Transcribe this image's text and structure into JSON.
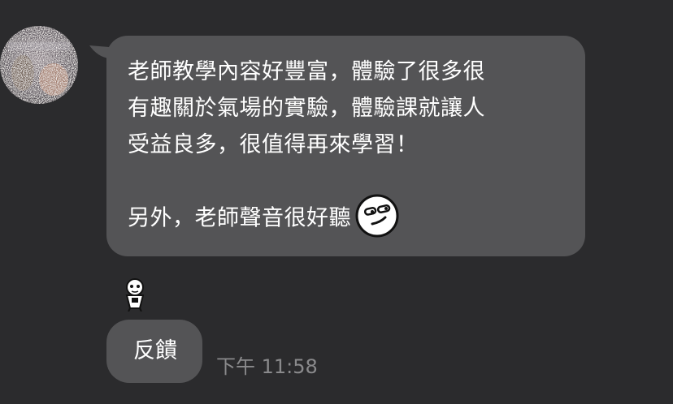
{
  "message": {
    "lines": [
      "老師教學內容好豐富，體驗了很多很",
      "有趣關於氣場的實驗，體驗課就讓人",
      "受益良多，很值得再來學習！",
      "",
      "另外，老師聲音很好聽"
    ],
    "emoji_icon": "smug-face-sticker-icon"
  },
  "reaction": {
    "icon": "small-character-sticker-icon"
  },
  "feedback_button": {
    "label": "反饋"
  },
  "timestamp": "下午 11:58",
  "colors": {
    "background": "#2b2b2d",
    "bubble": "#545456",
    "text": "#ffffff",
    "timestamp": "#8a8a8c"
  }
}
